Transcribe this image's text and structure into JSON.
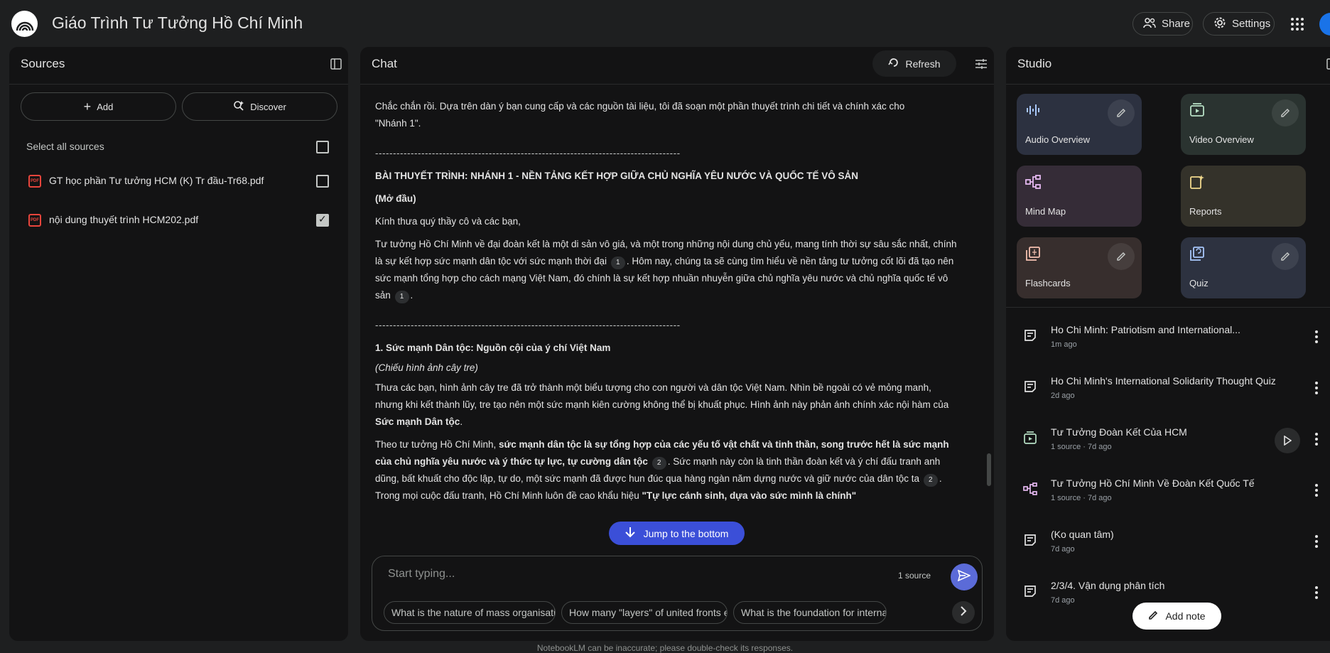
{
  "app": {
    "title": "Giáo Trình Tư Tưởng Hồ Chí Minh",
    "share_label": "Share",
    "settings_label": "Settings"
  },
  "sources": {
    "title": "Sources",
    "add_label": "Add",
    "discover_label": "Discover",
    "select_all_label": "Select all sources",
    "items": [
      {
        "label": "GT học phần Tư tưởng HCM (K) Tr đầu-Tr68.pdf",
        "checked": false
      },
      {
        "label": "nội dung thuyết trình HCM202.pdf",
        "checked": true
      }
    ]
  },
  "chat": {
    "title": "Chat",
    "refresh_label": "Refresh",
    "intro_line1": "Chắc chắn rồi. Dựa trên dàn ý bạn cung cấp và các nguồn tài liệu, tôi đã soạn một phần thuyết trình chi tiết và chính xác cho",
    "intro_line2": "\"Nhánh 1\".",
    "dashes": "--------------------------------------------------------------------------------------",
    "heading": "BÀI THUYẾT TRÌNH: NHÁNH 1 - NỀN TẢNG KẾT HỢP GIỮA CHỦ NGHĨA YÊU NƯỚC VÀ QUỐC TẾ VÔ SẢN",
    "opening": "(Mở đầu)",
    "greeting": "Kính thưa quý thầy cô và các bạn,",
    "para1_a": "Tư tưởng Hồ Chí Minh về đại đoàn kết là một di sản vô giá, và một trong những nội dung chủ yếu, mang tính thời sự sâu sắc nhất, chính là sự kết hợp sức mạnh dân tộc với sức mạnh thời đại",
    "para1_b": ". Hôm nay, chúng ta sẽ cùng tìm hiểu về nền tảng tư tưởng cốt lõi đã tạo nên sức mạnh tổng hợp cho cách mạng Việt Nam, đó chính là sự kết hợp nhuần nhuyễn giữa chủ nghĩa yêu nước và chủ nghĩa quốc tế vô sản",
    "para1_c": ".",
    "cite1": "1",
    "cite2": "2",
    "section1": "1. Sức mạnh Dân tộc: Nguồn cội của ý chí Việt Nam",
    "section1_note": "(Chiếu hình ảnh cây tre)",
    "para2_a": "Thưa các bạn, hình ảnh cây tre đã trở thành một biểu tượng cho con người và dân tộc Việt Nam. Nhìn bề ngoài có vẻ mỏng manh, nhưng khi kết thành lũy, tre tạo nên một sức mạnh kiên cường không thể bị khuất phục. Hình ảnh này phản ánh chính xác nội hàm của",
    "para2_b": "Sức mạnh Dân tộc",
    "para2_c": ".",
    "para3_a": "Theo tư tưởng Hồ Chí Minh, ",
    "para3_b": "sức mạnh dân tộc là sự tổng hợp của các yếu tố vật chất và tinh thần, song trước hết là sức mạnh của chủ nghĩa yêu nước và ý thức tự lực, tự cường dân tộc",
    "para3_c": ". Sức mạnh này còn là tinh thần đoàn kết và ý chí đấu tranh anh dũng, bất khuất cho độc lập, tự do, một sức mạnh đã được hun đúc qua hàng ngàn năm dựng nước và giữ nước của dân tộc ta",
    "para3_d": ". Trong mọi cuộc đấu tranh, Hồ Chí Minh luôn đề cao khẩu hiệu ",
    "para3_e": "\"Tự lực cánh sinh, dựa vào sức mình là chính\"",
    "jump_label": "Jump to the bottom",
    "input_placeholder": "Start typing...",
    "source_count": "1 source",
    "suggestions": [
      "What is the nature of mass organisations?",
      "How many \"layers\" of united fronts exist?",
      "What is the foundation for international solidarity?"
    ],
    "footer": "NotebookLM can be inaccurate; please double-check its responses."
  },
  "studio": {
    "title": "Studio",
    "tiles": [
      {
        "label": "Audio Overview",
        "color": "#2c3140"
      },
      {
        "label": "Video Overview",
        "color": "#2a3330"
      },
      {
        "label": "Mind Map",
        "color": "#352c37"
      },
      {
        "label": "Reports",
        "color": "#34322a"
      },
      {
        "label": "Flashcards",
        "color": "#372e2d"
      },
      {
        "label": "Quiz",
        "color": "#2d3240"
      }
    ],
    "notes": [
      {
        "title": "Ho Chi Minh: Patriotism and International...",
        "meta": "1m ago",
        "icon": "note-icon"
      },
      {
        "title": "Ho Chi Minh's International Solidarity Thought Quiz",
        "meta": "2d ago",
        "icon": "note-icon"
      },
      {
        "title": "Tư Tưởng Đoàn Kết Của HCM",
        "meta": "1 source · 7d ago",
        "icon": "video-icon"
      },
      {
        "title": "Tư Tưởng Hồ Chí Minh Về Đoàn Kết Quốc Tế",
        "meta": "1 source · 7d ago",
        "icon": "mindmap-icon"
      },
      {
        "title": "(Ko quan tâm)",
        "meta": "7d ago",
        "icon": "note-icon"
      },
      {
        "title": "2/3/4. Vận dụng phân tích",
        "meta": "7d ago",
        "icon": "note-icon"
      }
    ],
    "add_note_label": "Add note"
  }
}
